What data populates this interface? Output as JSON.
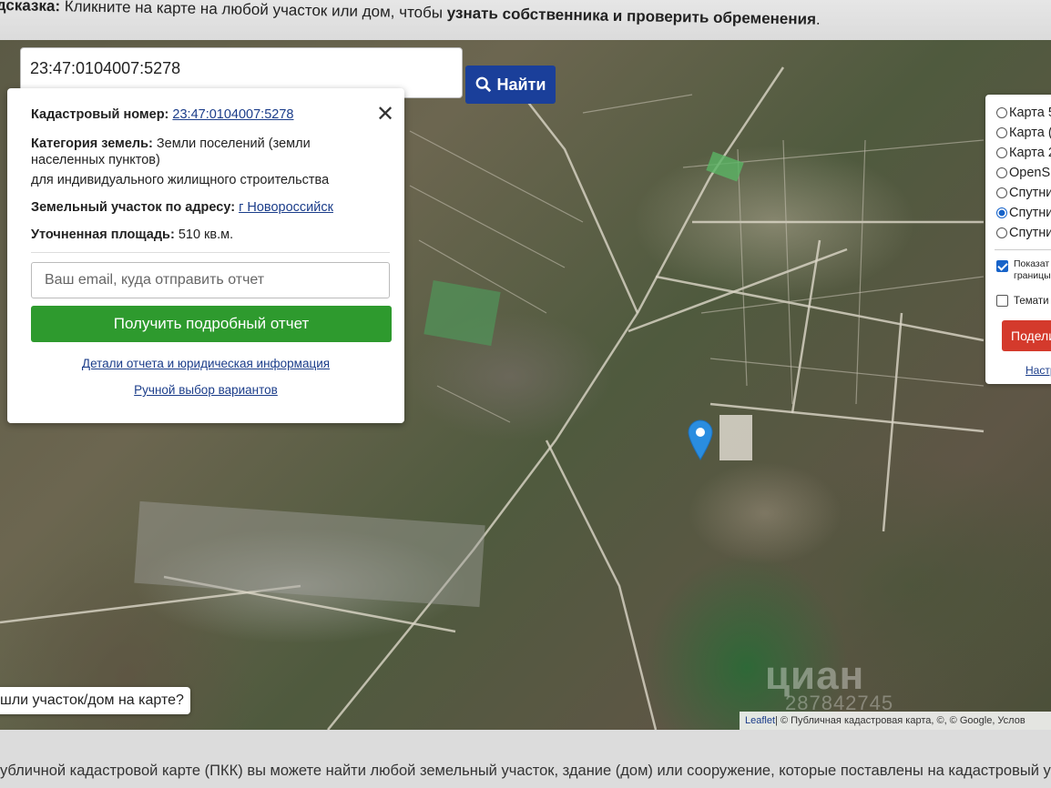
{
  "hint": {
    "prefix": "дсказка:",
    "text": " Кликните на карте на любой участок или дом, чтобы ",
    "bold": "узнать собственника и проверить обременения",
    "suffix": "."
  },
  "search": {
    "value": "23:47:0104007:5278",
    "button_label": "Найти",
    "button_icon": "search-icon"
  },
  "info_card": {
    "cadastral_label": "Кадастровый номер:",
    "cadastral_value": "23:47:0104007:5278",
    "category_label": "Категория земель:",
    "category_value": "Земли поселений (земли населенных пунктов)",
    "category_use": "для индивидуального жилищного строительства",
    "address_label": "Земельный участок по адресу:",
    "address_value": "г Новороссийск",
    "area_label": "Уточненная площадь:",
    "area_value": "510 кв.м.",
    "email_placeholder": "Ваш email, куда отправить отчет",
    "report_button": "Получить подробный отчет",
    "details_link": "Детали отчета и юридическая информация",
    "manual_link": "Ручной выбор вариантов"
  },
  "layers": {
    "items": [
      {
        "label": "Карта 5",
        "selected": false
      },
      {
        "label": "Карта (",
        "selected": false
      },
      {
        "label": "Карта 2",
        "selected": false
      },
      {
        "label": "OpenS",
        "selected": false
      },
      {
        "label": "Спутни",
        "selected": false
      },
      {
        "label": "Спутни",
        "selected": true
      },
      {
        "label": "Спутни",
        "selected": false
      }
    ],
    "checkbox_show_line1": "Показат",
    "checkbox_show_line2": "границы",
    "checkbox_show_checked": true,
    "checkbox_thematic": "Темати",
    "checkbox_thematic_checked": false,
    "share_label": "Подели",
    "settings_link": "Настр"
  },
  "map": {
    "found_button": "шли участок/дом на карте?",
    "attribution_leaflet": "Leaflet",
    "attribution_rest": " | © Публичная кадастровая карта, ©, © Google, Услов",
    "watermark": "циан",
    "watermark_id": "287842745"
  },
  "bottom_text": "убличной кадастровой карте (ПКК) вы можете найти любой земельный участок, здание (дом) или сооружение, которые поставлены на кадастровый у"
}
